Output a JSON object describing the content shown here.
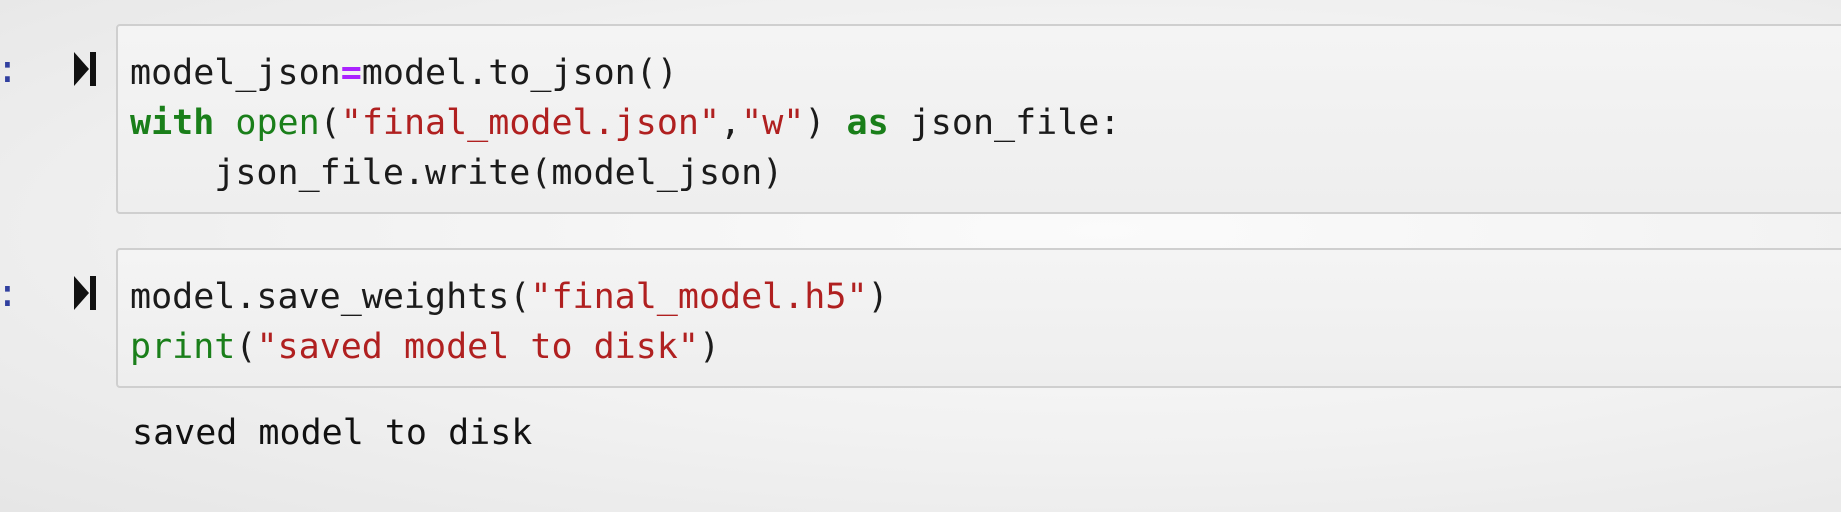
{
  "cells": [
    {
      "prompt": ":",
      "run_icon": "run-cell-icon",
      "code": {
        "line1": {
          "a": "model_json",
          "op": "=",
          "b": "model.to_json()"
        },
        "line2": {
          "kw_with": "with",
          "sp1": " ",
          "fn_open": "open",
          "paren_open": "(",
          "str_file": "\"final_model.json\"",
          "comma": ",",
          "str_mode": "\"w\"",
          "paren_close": ") ",
          "kw_as": "as",
          "rest": " json_file:"
        },
        "line3": {
          "text": "    json_file.write(model_json)"
        }
      }
    },
    {
      "prompt": ":",
      "run_icon": "run-cell-icon",
      "code": {
        "line1": {
          "a": "model.save_weights(",
          "str": "\"final_model.h5\"",
          "b": ")"
        },
        "line2": {
          "fn_print": "print",
          "a": "(",
          "str": "\"saved model to disk\"",
          "b": ")"
        }
      },
      "output": "saved model to disk"
    }
  ],
  "colors": {
    "keyword": "#1a7f1a",
    "builtin": "#1a7f1a",
    "string": "#b02020",
    "operator": "#aa22ff",
    "prompt": "#303f9f"
  }
}
